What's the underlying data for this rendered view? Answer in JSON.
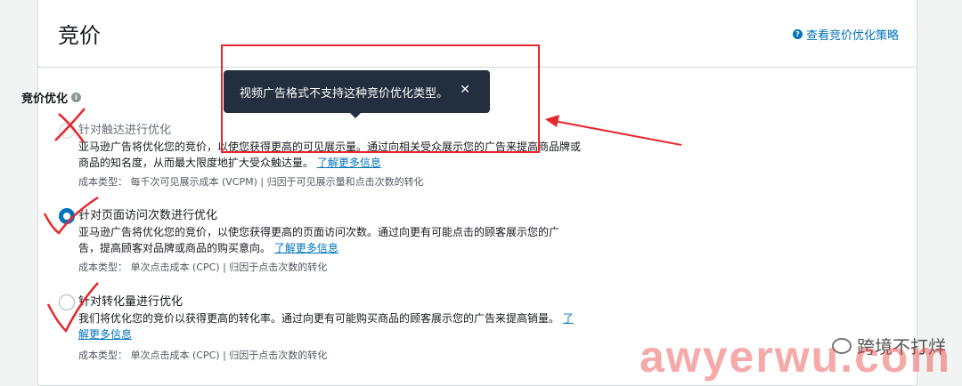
{
  "header": {
    "title": "竞价",
    "help_link": "查看竞价优化策略"
  },
  "section": {
    "label": "竞价优化",
    "info_icon": "info-icon"
  },
  "tooltip": {
    "message": "视频广告格式不支持这种竞价优化类型。",
    "close_glyph": "✕"
  },
  "options": [
    {
      "title": "针对触达进行优化",
      "desc_line1": "亚马逊广告将优化您的竞价，以使您获得更高的可见展示量。通过向相关受众展示您的广告来提高商品牌或",
      "desc_line2": "商品的知名度，从而最大限度地扩大受众触达量。",
      "link": "了解更多信息",
      "meta": "成本类型：  每千次可见展示成本 (VCPM) | 归因于可见展示量和点击次数的转化",
      "state": "disabled"
    },
    {
      "title": "针对页面访问次数进行优化",
      "desc_line1": "亚马逊广告将优化您的竞价，以使您获得更高的页面访问次数。通过向更有可能点击的顾客展示您的广",
      "desc_line2": "告，提高顾客对品牌或商品的购买意向。",
      "link": "了解更多信息",
      "meta": "成本类型：  单次点击成本 (CPC) | 归因于点击次数的转化",
      "state": "checked"
    },
    {
      "title": "针对转化量进行优化",
      "desc_line1": "我们将优化您的竞价以获得更高的转化率。通过向更有可能购买商品的顾客展示您的广告来提高销量。",
      "link_part1": "了",
      "link_part2": "解更多信息",
      "meta": "成本类型：  单次点击成本 (CPC) | 归因于点击次数的转化",
      "state": "unchecked"
    }
  ],
  "watermark": {
    "brand": "跨境不打烊",
    "site": "awyerwu.com"
  },
  "colors": {
    "accent": "#0073bb",
    "annotation": "#e8262b",
    "tooltip_bg": "#232f3e"
  }
}
